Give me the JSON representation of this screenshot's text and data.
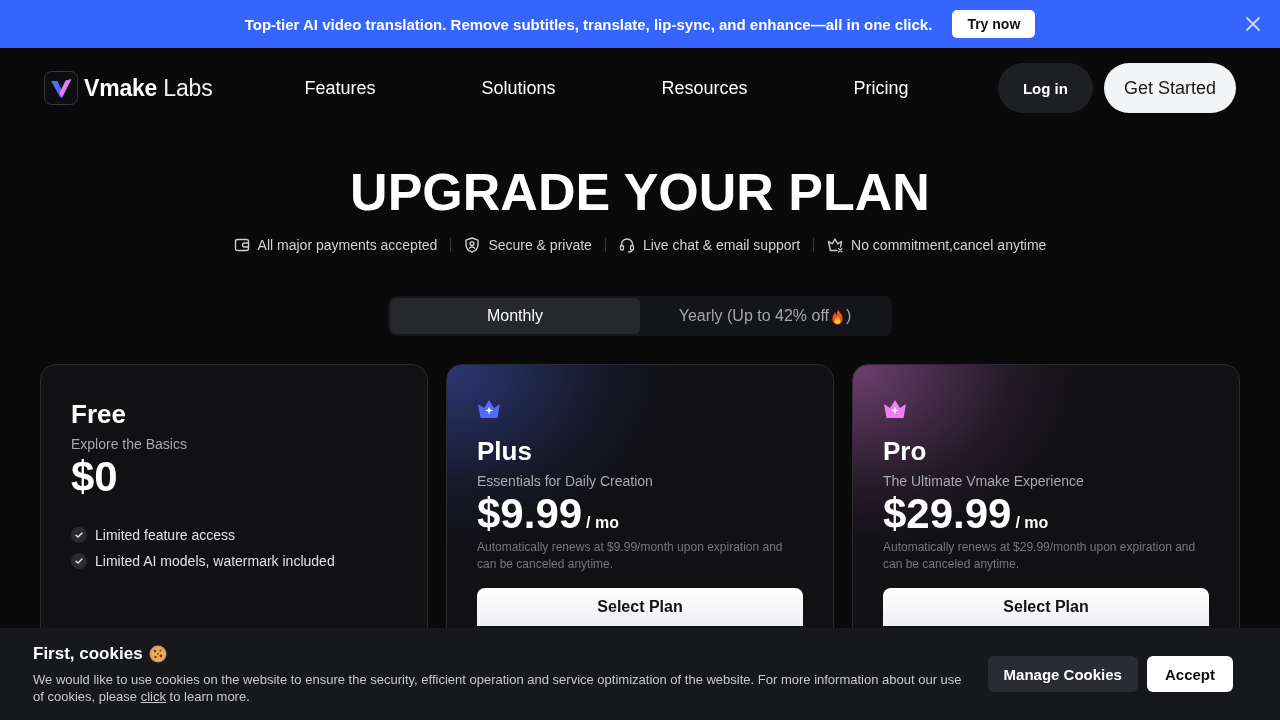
{
  "promo_banner": {
    "text": "Top-tier AI video translation. Remove subtitles, translate, lip-sync, and enhance—all in one click.",
    "button": "Try now"
  },
  "nav": {
    "logo": "**Vmake** Labs",
    "links": [
      "Features",
      "Solutions",
      "Resources",
      "Pricing"
    ],
    "login": "Log in",
    "cta": "Get Started"
  },
  "heading": "UPGRADE YOUR PLAN",
  "assurances": [
    "All major payments accepted",
    "Secure & private",
    "Live chat & email support",
    "No commitment,cancel anytime"
  ],
  "billing": {
    "tabs": [
      {
        "label": "Monthly",
        "selected": true
      },
      {
        "label": "Yearly (Up to 42% off",
        "label_end": ")",
        "selected": false
      }
    ]
  },
  "plans": [
    {
      "kind": "basic",
      "name": "Free",
      "tagline": "Explore the Basics",
      "price": "$0",
      "features": [
        "Limited feature access",
        "Limited AI models, watermark included"
      ]
    },
    {
      "kind": "premium",
      "color": "#4f6bff",
      "name": "Plus",
      "tagline": "Essentials for Daily Creation",
      "price": "$9.99",
      "period": "/ mo",
      "note": "Automatically renews at $9.99/month upon expiration and can be canceled anytime.",
      "button": "Select Plan"
    },
    {
      "kind": "premium",
      "color": "#f07ef2",
      "name": "Pro",
      "tagline": "The Ultimate Vmake Experience",
      "price": "$29.99",
      "period": "/ mo",
      "note": "Automatically renews at $29.99/month upon expiration and can be canceled anytime.",
      "button": "Select Plan"
    }
  ],
  "cookie_notice": {
    "title": "First, cookies",
    "text_before": "We would like to use cookies on the website to ensure the security, efficient operation and service optimization of the website. For more information about our use of cookies, please",
    "link": "click",
    "text_after": "to learn more.",
    "manage_button": "Manage Cookies",
    "accept_button": "Accept"
  }
}
